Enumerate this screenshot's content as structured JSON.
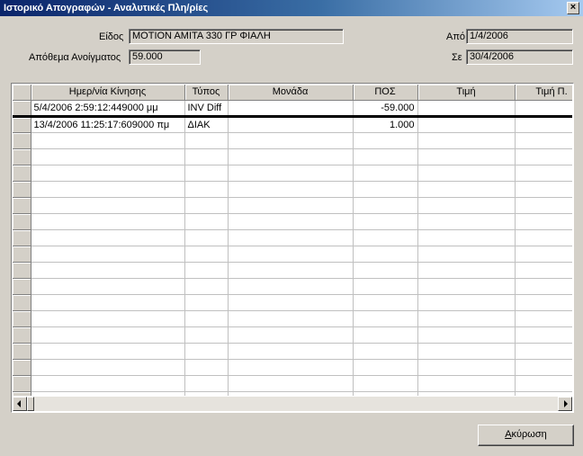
{
  "window": {
    "title": "Ιστορικό Απογραφών - Αναλυτικές Πλη/ρίες",
    "close_glyph": "×"
  },
  "form": {
    "item_label": "Είδος",
    "item_value": "MOTION AMITA 330 ΓΡ ΦΙΑΛΗ",
    "opening_stock_label": "Απόθεμα Ανοίγματος",
    "opening_stock_value": "59.000",
    "from_label": "Από",
    "from_value": "1/4/2006",
    "to_label": "Σε",
    "to_value": "30/4/2006"
  },
  "grid": {
    "columns": [
      "Ημερ/νία Κίνησης",
      "Τύπος",
      "Μονάδα",
      "ΠΟΣ",
      "Τιμή",
      "Τιμή Π."
    ],
    "rows": [
      {
        "date": "5/4/2006 2:59:12:449000 μμ",
        "type": "INV Diff",
        "unit": "",
        "qty": "-59.000",
        "price": "",
        "price2": ""
      },
      {
        "date": "13/4/2006 11:25:17:609000 πμ",
        "type": "ΔΙΑΚ",
        "unit": "",
        "qty": "1.000",
        "price": "",
        "price2": ""
      }
    ],
    "empty_rows": 17
  },
  "buttons": {
    "cancel_prefix": "",
    "cancel_mnemonic": "Α",
    "cancel_rest": "κύρωση"
  }
}
